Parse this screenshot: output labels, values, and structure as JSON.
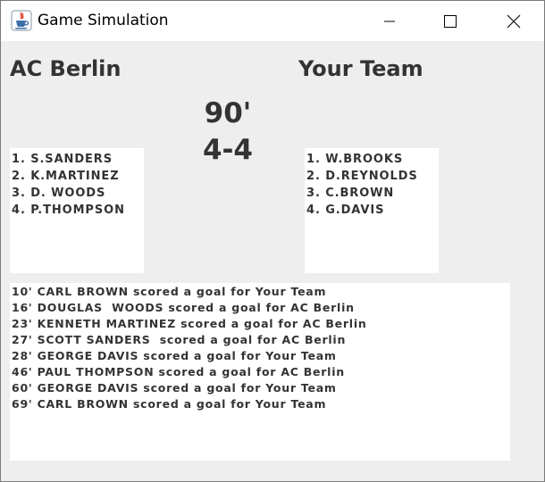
{
  "window": {
    "title": "Game Simulation",
    "icon": "java-cup-icon"
  },
  "match": {
    "home_team": "AC Berlin",
    "away_team": "Your Team",
    "time": "90'",
    "score": "4-4"
  },
  "home_lineup": [
    "1. S.SANDERS",
    "2. K.MARTINEZ",
    "3. D. WOODS",
    "4. P.THOMPSON"
  ],
  "away_lineup": [
    "1. W.BROOKS",
    "2. D.REYNOLDS",
    "3. C.BROWN",
    "4. G.DAVIS"
  ],
  "events": [
    "10' CARL BROWN scored a goal for Your Team",
    "16' DOUGLAS  WOODS scored a goal for AC Berlin",
    "23' KENNETH MARTINEZ scored a goal for AC Berlin",
    "27' SCOTT SANDERS  scored a goal for AC Berlin",
    "28' GEORGE DAVIS scored a goal for Your Team",
    "46' PAUL THOMPSON scored a goal for AC Berlin",
    "60' GEORGE DAVIS scored a goal for Your Team",
    "69' CARL BROWN scored a goal for Your Team"
  ]
}
